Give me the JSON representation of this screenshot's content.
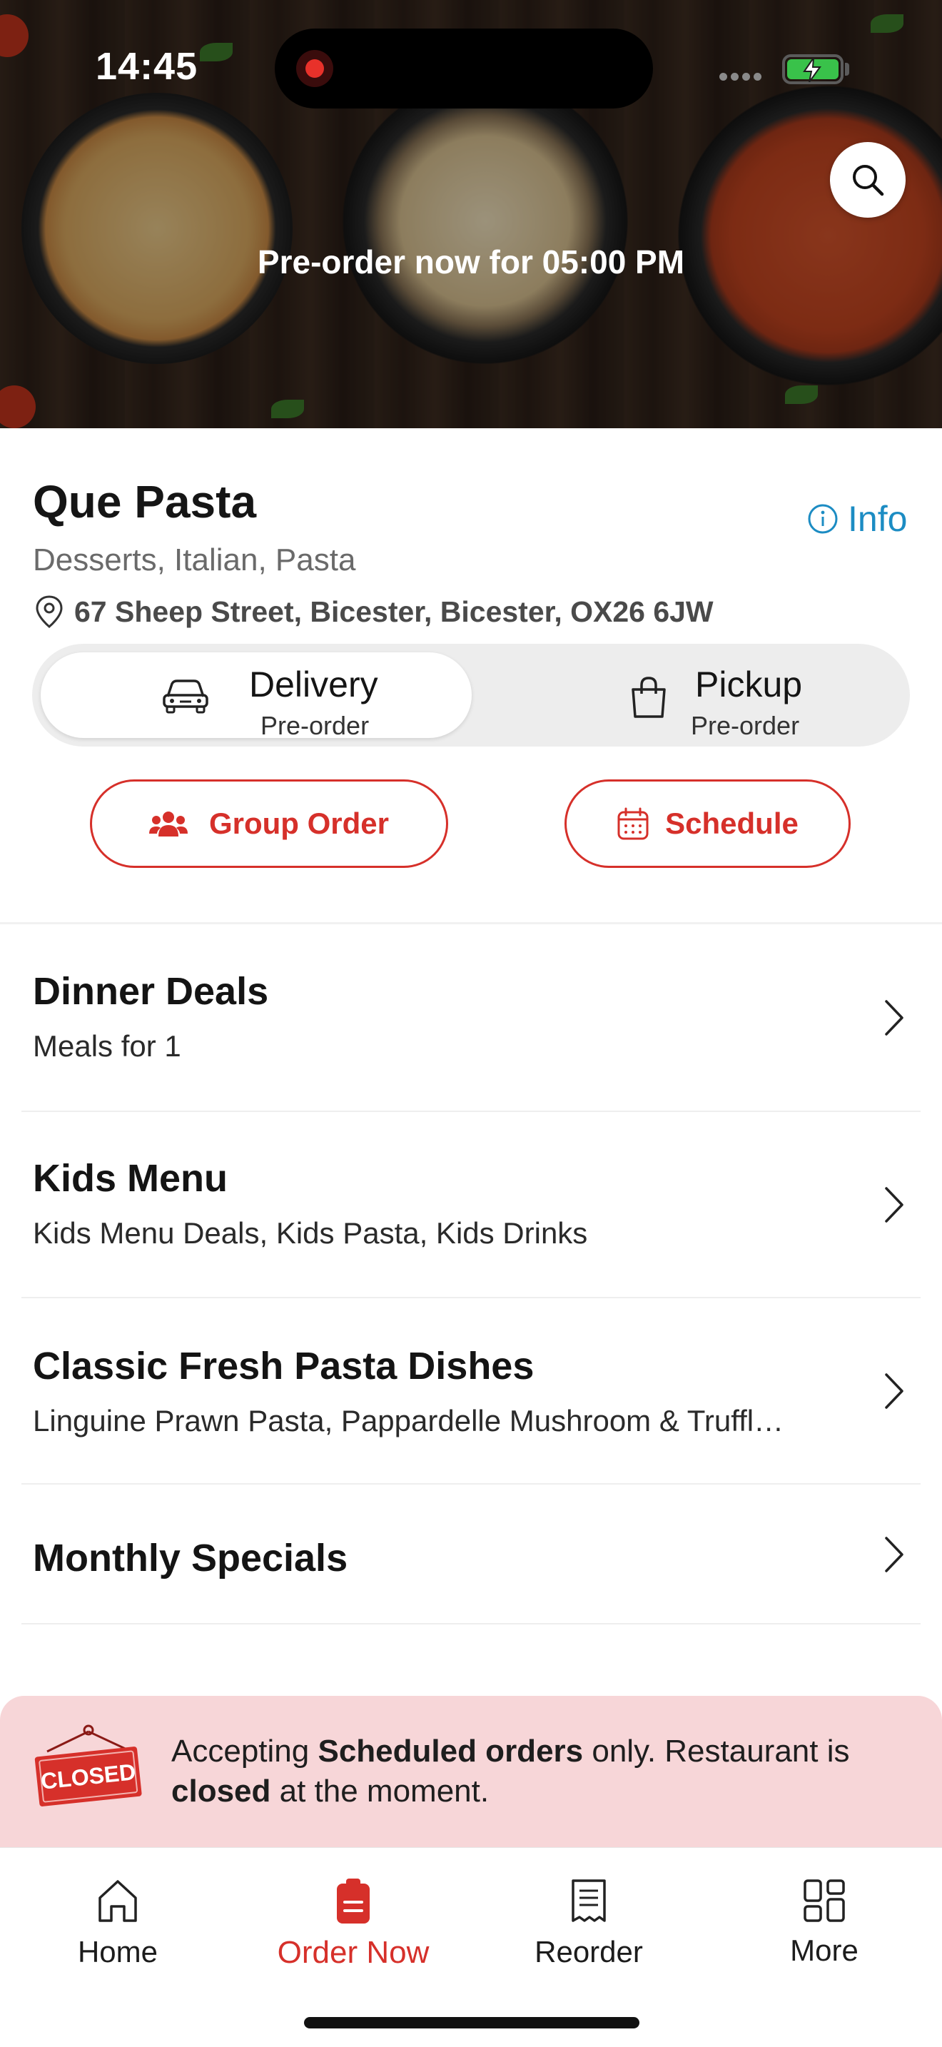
{
  "status_bar": {
    "time": "14:45"
  },
  "hero": {
    "preorder_text": "Pre-order now for 05:00 PM"
  },
  "restaurant": {
    "name": "Que Pasta",
    "info_label": "Info",
    "cuisines": "Desserts, Italian, Pasta",
    "address": "67 Sheep Street, Bicester, Bicester, OX26 6JW"
  },
  "order_mode": {
    "selected": "Delivery",
    "options": [
      {
        "label": "Delivery",
        "sub": "Pre-order",
        "icon": "car-icon"
      },
      {
        "label": "Pickup",
        "sub": "Pre-order",
        "icon": "shopping-bag-icon"
      }
    ]
  },
  "actions": {
    "group_order_label": "Group Order",
    "schedule_label": "Schedule"
  },
  "categories": [
    {
      "title": "Dinner Deals",
      "description": "Meals for 1"
    },
    {
      "title": "Kids Menu",
      "description": "Kids Menu Deals, Kids Pasta, Kids Drinks"
    },
    {
      "title": "Classic Fresh Pasta Dishes",
      "description": "Linguine Prawn Pasta, Pappardelle Mushroom & Truffl…"
    },
    {
      "title": "Monthly Specials",
      "description": ""
    }
  ],
  "notice": {
    "sign_text": "CLOSED",
    "part1": "Accepting ",
    "bold1": "Scheduled orders",
    "part2": " only. Restaurant is ",
    "bold2": "closed",
    "part3": " at the moment."
  },
  "tabbar": {
    "active": "Order Now",
    "items": [
      {
        "label": "Home",
        "icon": "home-icon"
      },
      {
        "label": "Order Now",
        "icon": "order-icon"
      },
      {
        "label": "Reorder",
        "icon": "receipt-icon"
      },
      {
        "label": "More",
        "icon": "grid-icon"
      }
    ]
  },
  "colors": {
    "accent": "#d6302a",
    "link": "#1c8cc3",
    "notice_bg": "#f7d6d8",
    "toggle_bg": "#ededed"
  }
}
